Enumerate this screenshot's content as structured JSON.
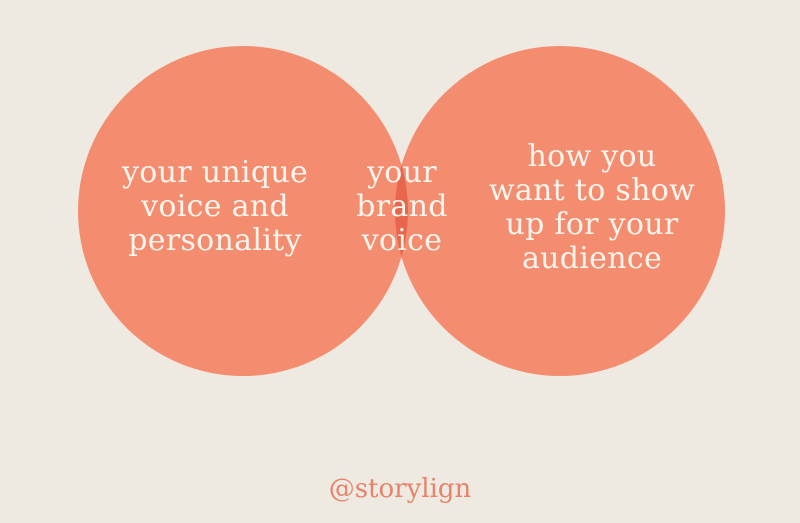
{
  "diagram": {
    "type": "venn",
    "colors": {
      "background": "#eee9e1",
      "circle": "#f48d6f",
      "overlap": "#e8664d",
      "label_text": "#fbf5ee",
      "handle_text": "#e6836a"
    },
    "left_set": {
      "lines": [
        "your unique",
        "voice and",
        "personality"
      ]
    },
    "intersection": {
      "lines": [
        "your",
        "brand",
        "voice"
      ]
    },
    "right_set": {
      "lines": [
        "how you",
        "want to show",
        "up for your",
        "audience"
      ]
    }
  },
  "footer": {
    "handle": "@storylign"
  }
}
